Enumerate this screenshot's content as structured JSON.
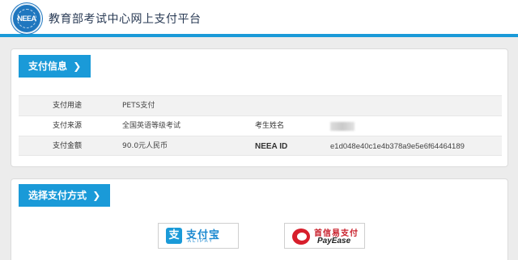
{
  "header": {
    "logo_text": "NEEA",
    "title": "教育部考试中心网上支付平台"
  },
  "payment_info": {
    "section_title": "支付信息",
    "chevron": "❯",
    "rows": [
      {
        "label": "支付用途",
        "value": "PETS支付"
      },
      {
        "label": "支付来源",
        "value": "全国英语等级考试",
        "label2": "考生姓名"
      },
      {
        "label": "支付金额",
        "value": "90.0元人民币",
        "label2": "NEEA ID",
        "value2": "e1d048e40c1e4b378a9e5e6f64464189"
      }
    ]
  },
  "payment_method": {
    "section_title": "选择支付方式",
    "chevron": "❯",
    "options": [
      {
        "name": "支付宝",
        "subtitle": "ALIPAY",
        "icon": "alipay-logo-icon",
        "color": "#1a9ad8"
      },
      {
        "name": "首信易支付",
        "subtitle": "PayEase",
        "icon": "payease-logo-icon",
        "color": "#d71e2b"
      }
    ]
  },
  "colors": {
    "accent": "#1a9ad8",
    "background": "#ececec"
  }
}
